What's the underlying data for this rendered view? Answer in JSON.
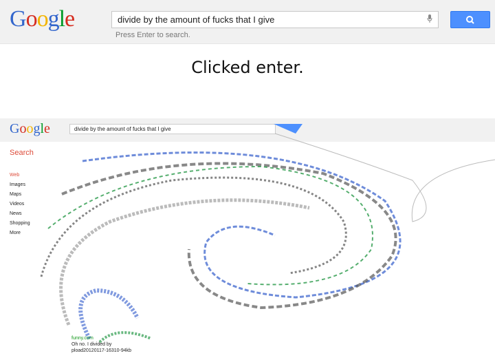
{
  "header": {
    "logo_letters": [
      "G",
      "o",
      "o",
      "g",
      "l",
      "e"
    ],
    "search_value": "divide by the amount of fucks that I give",
    "hint": "Press Enter to search."
  },
  "caption": "Clicked enter.",
  "embedded": {
    "logo_letters": [
      "G",
      "o",
      "o",
      "g",
      "l",
      "e"
    ],
    "search_value": "divide by the amount of fucks that I give",
    "search_label": "Search",
    "left_nav": [
      "Web",
      "Images",
      "Maps",
      "Videos",
      "News",
      "Shopping",
      "More"
    ],
    "footer": {
      "url": "funny.com",
      "snippet": "Oh no. I divided by",
      "id": "pload20120117-16310-94kb"
    }
  },
  "colors": {
    "accent": "#4d90fe",
    "red": "#dd4b39",
    "green": "#109618"
  }
}
